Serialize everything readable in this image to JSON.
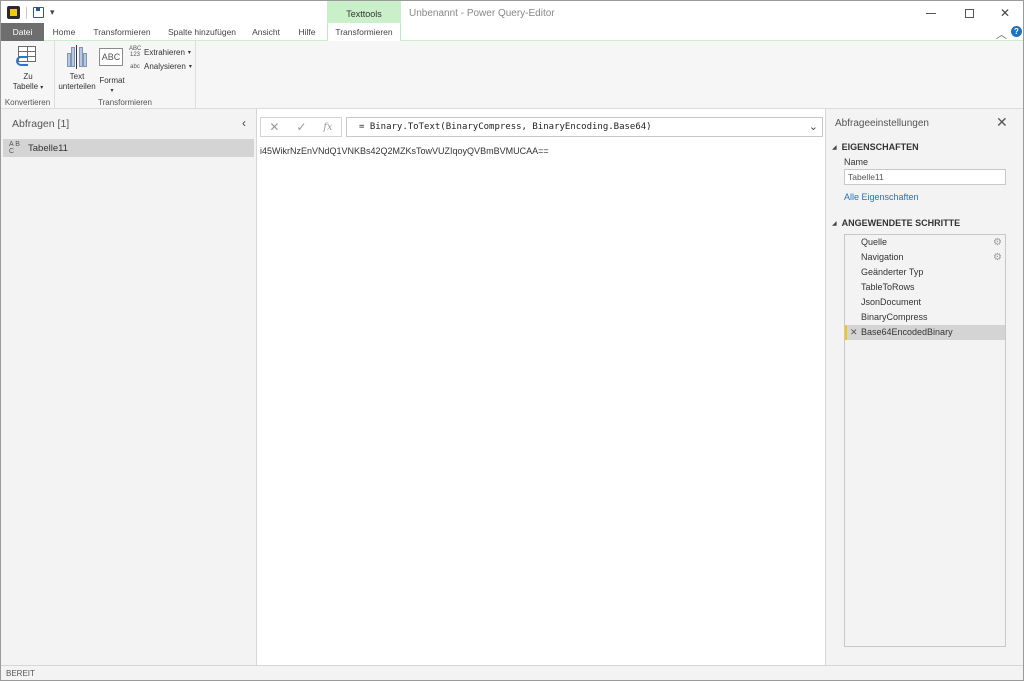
{
  "window": {
    "title": "Unbenannt - Power Query-Editor",
    "context_tab_group": "Texttools"
  },
  "tabs": [
    {
      "label": "Datei"
    },
    {
      "label": "Home"
    },
    {
      "label": "Transformieren"
    },
    {
      "label": "Spalte hinzufügen"
    },
    {
      "label": "Ansicht"
    },
    {
      "label": "Hilfe"
    },
    {
      "label": "Transformieren"
    }
  ],
  "ribbon": {
    "groups": {
      "konvertieren": {
        "label": "Konvertieren",
        "zu_tabelle_line1": "Zu",
        "zu_tabelle_line2": "Tabelle"
      },
      "transformieren": {
        "label": "Transformieren",
        "text_line1": "Text",
        "text_line2": "unterteilen",
        "format": "Format",
        "extrahieren": "Extrahieren",
        "analysieren": "Analysieren",
        "extrahieren_icon_text": "ABC 123",
        "analysieren_icon_text": "abc",
        "format_icon_text": "ABC"
      }
    }
  },
  "queries_panel": {
    "title": "Abfragen [1]",
    "items": [
      {
        "label": "Tabelle11",
        "icon_text": "A B C"
      }
    ]
  },
  "formula_bar": {
    "formula": "= Binary.ToText(BinaryCompress, BinaryEncoding.Base64)",
    "fx": "fx"
  },
  "result": {
    "value": "i45WikrNzEnVNdQ1VNKBs42Q2MZKsTowVUZIqoyQVBmBVMUCAA=="
  },
  "settings_panel": {
    "title": "Abfrageeinstellungen",
    "properties_heading": "EIGENSCHAFTEN",
    "name_label": "Name",
    "name_value": "Tabelle11",
    "all_properties": "Alle Eigenschaften",
    "steps_heading": "ANGEWENDETE SCHRITTE",
    "steps": [
      {
        "label": "Quelle",
        "has_gear": true
      },
      {
        "label": "Navigation",
        "has_gear": true
      },
      {
        "label": "Geänderter Typ",
        "has_gear": false
      },
      {
        "label": "TableToRows",
        "has_gear": false
      },
      {
        "label": "JsonDocument",
        "has_gear": false
      },
      {
        "label": "BinaryCompress",
        "has_gear": false
      },
      {
        "label": "Base64EncodedBinary",
        "has_gear": false,
        "selected": true
      }
    ]
  },
  "status": {
    "text": "BEREIT"
  }
}
